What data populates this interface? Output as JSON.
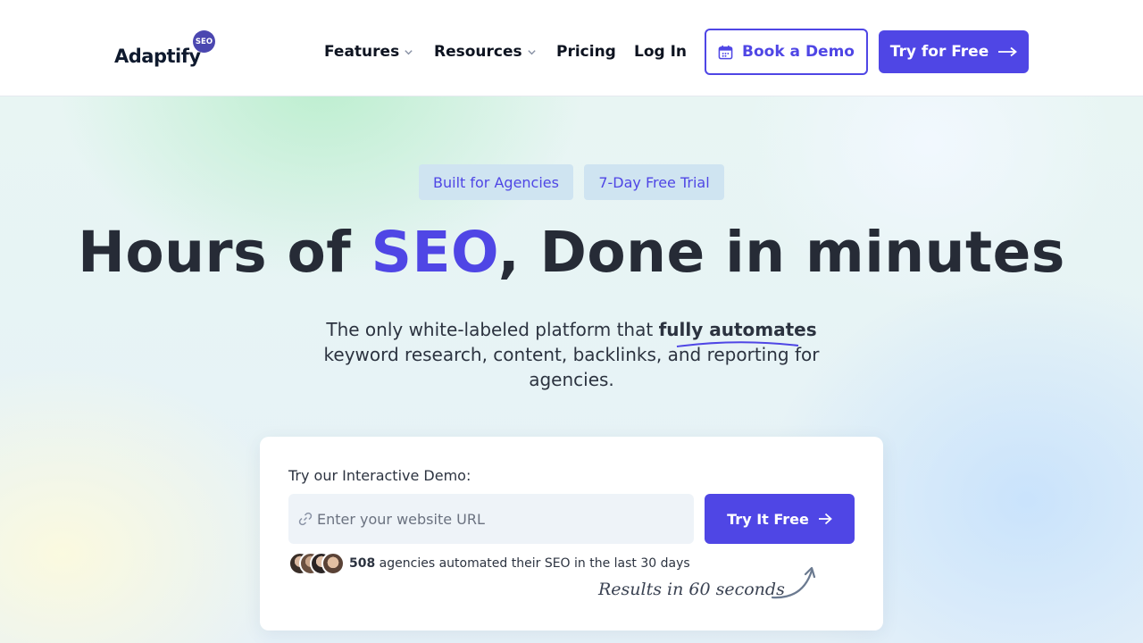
{
  "logo": {
    "text": "Adaptify",
    "badge": "SEO"
  },
  "nav": {
    "items": [
      {
        "label": "Features",
        "has_dropdown": true
      },
      {
        "label": "Resources",
        "has_dropdown": true
      },
      {
        "label": "Pricing",
        "has_dropdown": false
      },
      {
        "label": "Log In",
        "has_dropdown": false
      }
    ],
    "book_demo_label": "Book a Demo",
    "try_free_label": "Try for Free"
  },
  "hero": {
    "pills": [
      "Built for Agencies",
      "7-Day Free Trial"
    ],
    "headline_part1": "Hours of ",
    "headline_accent": "SEO",
    "headline_part2": ", Done in minutes",
    "subtitle_before": "The only white-labeled platform that ",
    "subtitle_strong": "fully automates",
    "subtitle_after": " keyword research, content, backlinks, and reporting for agencies."
  },
  "demo_card": {
    "label": "Try our Interactive Demo:",
    "input_placeholder": "Enter your website URL",
    "input_value": "",
    "button_label": "Try It Free",
    "agency_count": "508",
    "social_proof_text": " agencies automated their SEO in the last 30 days",
    "handwritten_note": "Results in 60 seconds"
  },
  "colors": {
    "accent": "#4f46e5",
    "headline": "#262b36",
    "pill_bg": "#cfe4f1"
  }
}
